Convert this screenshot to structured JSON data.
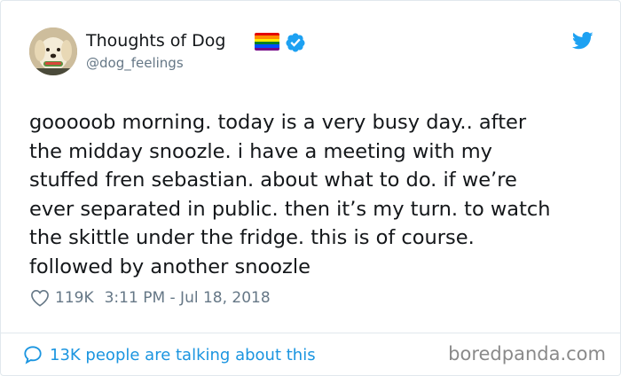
{
  "header": {
    "display_name": "Thoughts of Dog",
    "handle": "@dog_feelings",
    "avatar_icon": "dog-avatar-icon",
    "badge_icon": "rainbow-flag-icon",
    "verified_icon": "verified-badge-icon",
    "platform_icon": "twitter-bird-icon"
  },
  "tweet": {
    "text": "gooooob morning. today is a very busy day.. after\nthe midday snoozle. i have a meeting with my\nstuffed fren sebastian. about what to do. if we’re\never separated in public. then it’s my turn. to watch\nthe skittle under the fridge. this is of course.\nfollowed by another snoozle"
  },
  "meta": {
    "likes": "119K",
    "timestamp": "3:11 PM - Jul 18, 2018",
    "heart_icon": "heart-icon"
  },
  "footer": {
    "talk_text": "13K people are talking about this",
    "talk_icon": "speech-bubble-icon",
    "watermark": "boredpanda.com"
  },
  "colors": {
    "accent": "#1da1f2",
    "link": "#1b95e0",
    "secondary_text": "#657786",
    "border": "#e1e8ed"
  }
}
